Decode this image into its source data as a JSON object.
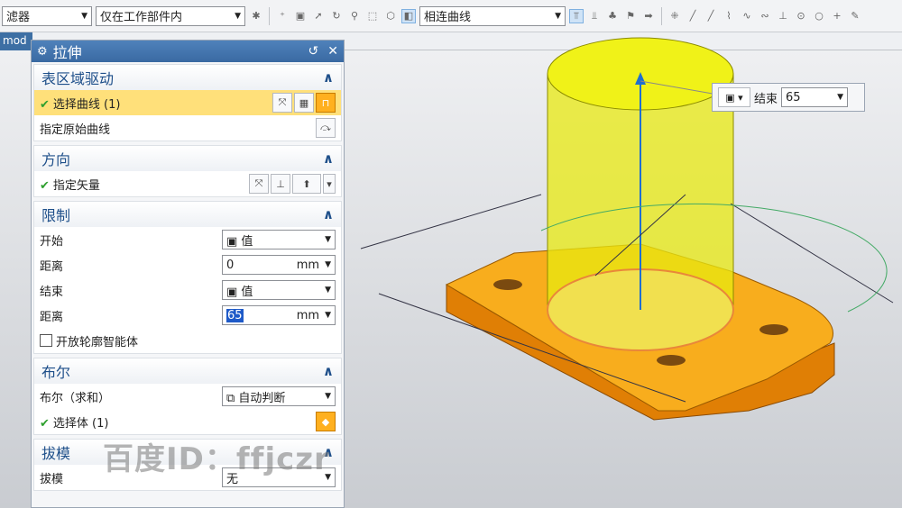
{
  "toolbar": {
    "filter_label": "滤器",
    "scope_label": "仅在工作部件内",
    "curve_rule_label": "相连曲线"
  },
  "tab": {
    "label": "mod"
  },
  "dialog": {
    "title": "拉伸",
    "sections": {
      "region": {
        "header": "表区域驱动",
        "select_curve": "选择曲线 (1)",
        "specify_curve": "指定原始曲线"
      },
      "direction": {
        "header": "方向",
        "specify_vector": "指定矢量"
      },
      "limits": {
        "header": "限制",
        "start_label": "开始",
        "start_value": "值",
        "start_distance_label": "距离",
        "start_distance": "0",
        "end_label": "结束",
        "end_value": "值",
        "end_distance_label": "距离",
        "end_distance": "65",
        "unit": "mm",
        "open_profile": "开放轮廓智能体"
      },
      "boolean": {
        "header": "布尔",
        "bool_label": "布尔（求和）",
        "bool_value": "自动判断",
        "select_body": "选择体 (1)"
      },
      "draft": {
        "header": "拔模",
        "draft_label": "拔模",
        "draft_value": "无"
      }
    }
  },
  "end_box": {
    "label": "结束",
    "value": "65"
  },
  "watermark": "百度ID：ffjczr",
  "colors": {
    "accent": "#3a6aa2",
    "selection": "#ffe07a",
    "cylinder": "#e8ea10",
    "base": "#f5a311"
  }
}
